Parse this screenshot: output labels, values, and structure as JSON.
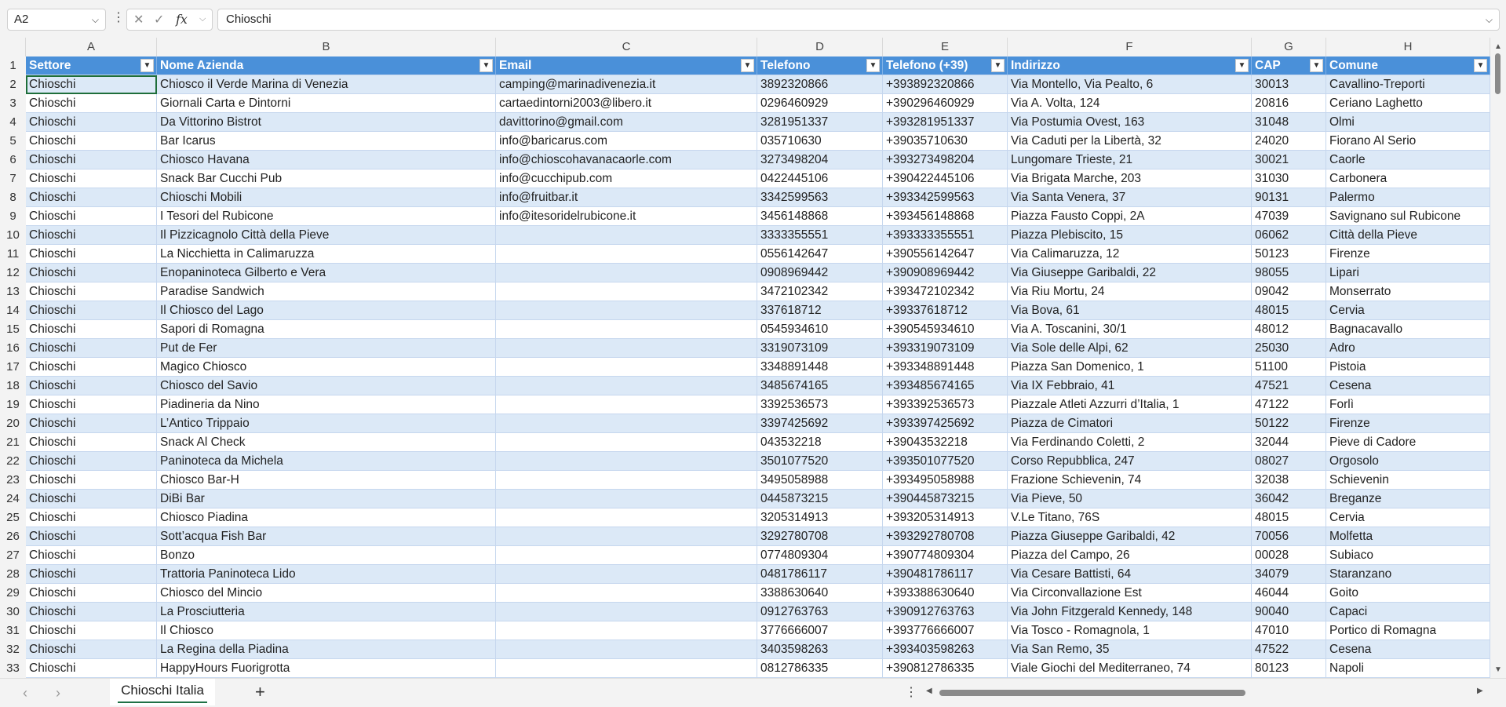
{
  "formula_bar": {
    "name_box": "A2",
    "fx_label": "fx",
    "cancel_glyph": "✕",
    "enter_glyph": "✓",
    "formula": "Chioschi"
  },
  "columns": [
    "A",
    "B",
    "C",
    "D",
    "E",
    "F",
    "G",
    "H"
  ],
  "row_numbers": [
    "1",
    "2",
    "3",
    "4",
    "5",
    "6",
    "7",
    "8",
    "9",
    "10",
    "11",
    "12",
    "13",
    "14",
    "15",
    "16",
    "17",
    "18",
    "19",
    "20",
    "21",
    "22",
    "23",
    "24",
    "25",
    "26",
    "27",
    "28",
    "29",
    "30",
    "31",
    "32",
    "33"
  ],
  "headers": [
    "Settore",
    "Nome Azienda",
    "Email",
    "Telefono",
    "Telefono (+39)",
    "Indirizzo",
    "CAP",
    "Comune"
  ],
  "rows": [
    [
      "Chioschi",
      "Chiosco il Verde Marina di Venezia",
      "camping@marinadivenezia.it",
      "3892320866",
      "+393892320866",
      "Via Montello, Via Pealto, 6",
      "30013",
      "Cavallino-Treporti"
    ],
    [
      "Chioschi",
      "Giornali Carta e Dintorni",
      "cartaedintorni2003@libero.it",
      "0296460929",
      "+390296460929",
      "Via A. Volta, 124",
      "20816",
      "Ceriano Laghetto"
    ],
    [
      "Chioschi",
      "Da Vittorino Bistrot",
      "davittorino@gmail.com",
      "3281951337",
      "+393281951337",
      "Via Postumia Ovest, 163",
      "31048",
      "Olmi"
    ],
    [
      "Chioschi",
      "Bar Icarus",
      "info@baricarus.com",
      "035710630",
      "+39035710630",
      "Via Caduti per la Libertà, 32",
      "24020",
      "Fiorano Al Serio"
    ],
    [
      "Chioschi",
      "Chiosco Havana",
      "info@chioscohavanacaorle.com",
      "3273498204",
      "+393273498204",
      "Lungomare Trieste, 21",
      "30021",
      "Caorle"
    ],
    [
      "Chioschi",
      "Snack Bar Cucchi Pub",
      "info@cucchipub.com",
      "0422445106",
      "+390422445106",
      "Via Brigata Marche, 203",
      "31030",
      "Carbonera"
    ],
    [
      "Chioschi",
      "Chioschi Mobili",
      "info@fruitbar.it",
      "3342599563",
      "+393342599563",
      "Via Santa Venera, 37",
      "90131",
      "Palermo"
    ],
    [
      "Chioschi",
      "I Tesori del Rubicone",
      "info@itesoridelrubicone.it",
      "3456148868",
      "+393456148868",
      "Piazza Fausto Coppi, 2A",
      "47039",
      "Savignano sul Rubicone"
    ],
    [
      "Chioschi",
      "Il Pizzicagnolo Città della Pieve",
      "",
      "3333355551",
      "+393333355551",
      "Piazza Plebiscito, 15",
      "06062",
      "Città della Pieve"
    ],
    [
      "Chioschi",
      "La Nicchietta in Calimaruzza",
      "",
      "0556142647",
      "+390556142647",
      "Via Calimaruzza, 12",
      "50123",
      "Firenze"
    ],
    [
      "Chioschi",
      "Enopaninoteca Gilberto e Vera",
      "",
      "0908969442",
      "+390908969442",
      "Via Giuseppe Garibaldi, 22",
      "98055",
      "Lipari"
    ],
    [
      "Chioschi",
      "Paradise Sandwich",
      "",
      "3472102342",
      "+393472102342",
      "Via Riu Mortu, 24",
      "09042",
      "Monserrato"
    ],
    [
      "Chioschi",
      "Il Chiosco del Lago",
      "",
      "337618712",
      "+39337618712",
      "Via Bova, 61",
      "48015",
      "Cervia"
    ],
    [
      "Chioschi",
      "Sapori di Romagna",
      "",
      "0545934610",
      "+390545934610",
      "Via A. Toscanini, 30/1",
      "48012",
      "Bagnacavallo"
    ],
    [
      "Chioschi",
      "Put de Fer",
      "",
      "3319073109",
      "+393319073109",
      "Via Sole delle Alpi, 62",
      "25030",
      "Adro"
    ],
    [
      "Chioschi",
      "Magico Chiosco",
      "",
      "3348891448",
      "+393348891448",
      "Piazza San Domenico, 1",
      "51100",
      "Pistoia"
    ],
    [
      "Chioschi",
      "Chiosco del Savio",
      "",
      "3485674165",
      "+393485674165",
      "Via IX Febbraio, 41",
      "47521",
      "Cesena"
    ],
    [
      "Chioschi",
      "Piadineria da Nino",
      "",
      "3392536573",
      "+393392536573",
      "Piazzale Atleti Azzurri d’Italia, 1",
      "47122",
      "Forlì"
    ],
    [
      "Chioschi",
      "L’Antico Trippaio",
      "",
      "3397425692",
      "+393397425692",
      "Piazza de Cimatori",
      "50122",
      "Firenze"
    ],
    [
      "Chioschi",
      "Snack Al Check",
      "",
      "043532218",
      "+39043532218",
      "Via Ferdinando Coletti, 2",
      "32044",
      "Pieve di Cadore"
    ],
    [
      "Chioschi",
      "Paninoteca da Michela",
      "",
      "3501077520",
      "+393501077520",
      "Corso Repubblica, 247",
      "08027",
      "Orgosolo"
    ],
    [
      "Chioschi",
      "Chiosco Bar-H",
      "",
      "3495058988",
      "+393495058988",
      "Frazione Schievenin, 74",
      "32038",
      "Schievenin"
    ],
    [
      "Chioschi",
      "DiBi Bar",
      "",
      "0445873215",
      "+390445873215",
      "Via Pieve, 50",
      "36042",
      "Breganze"
    ],
    [
      "Chioschi",
      "Chiosco Piadina",
      "",
      "3205314913",
      "+393205314913",
      "V.Le Titano, 76S",
      "48015",
      "Cervia"
    ],
    [
      "Chioschi",
      "Sott’acqua Fish Bar",
      "",
      "3292780708",
      "+393292780708",
      "Piazza Giuseppe Garibaldi, 42",
      "70056",
      "Molfetta"
    ],
    [
      "Chioschi",
      "Bonzo",
      "",
      "0774809304",
      "+390774809304",
      "Piazza del Campo, 26",
      "00028",
      "Subiaco"
    ],
    [
      "Chioschi",
      "Trattoria Paninoteca Lido",
      "",
      "0481786117",
      "+390481786117",
      "Via Cesare Battisti, 64",
      "34079",
      "Staranzano"
    ],
    [
      "Chioschi",
      "Chiosco del Mincio",
      "",
      "3388630640",
      "+393388630640",
      "Via Circonvallazione Est",
      "46044",
      "Goito"
    ],
    [
      "Chioschi",
      "La Prosciutteria",
      "",
      "0912763763",
      "+390912763763",
      "Via John Fitzgerald Kennedy, 148",
      "90040",
      "Capaci"
    ],
    [
      "Chioschi",
      "Il Chiosco",
      "",
      "3776666007",
      "+393776666007",
      "Via Tosco - Romagnola, 1",
      "47010",
      "Portico di Romagna"
    ],
    [
      "Chioschi",
      "La Regina della Piadina",
      "",
      "3403598263",
      "+393403598263",
      "Via San Remo, 35",
      "47522",
      "Cesena"
    ],
    [
      "Chioschi",
      "HappyHours Fuorigrotta",
      "",
      "0812786335",
      "+390812786335",
      "Viale Giochi del Mediterraneo, 74",
      "80123",
      "Napoli"
    ]
  ],
  "sheet_tab": "Chioschi Italia",
  "icons": {
    "filter": "filter-dropdown-icon",
    "add_sheet": "plus-icon",
    "nav_prev": "chevron-left-icon",
    "nav_next": "chevron-right-icon"
  },
  "colors": {
    "header_fill": "#4a90d9",
    "band_fill": "#dce9f7",
    "tab_underline": "#1e7145"
  }
}
